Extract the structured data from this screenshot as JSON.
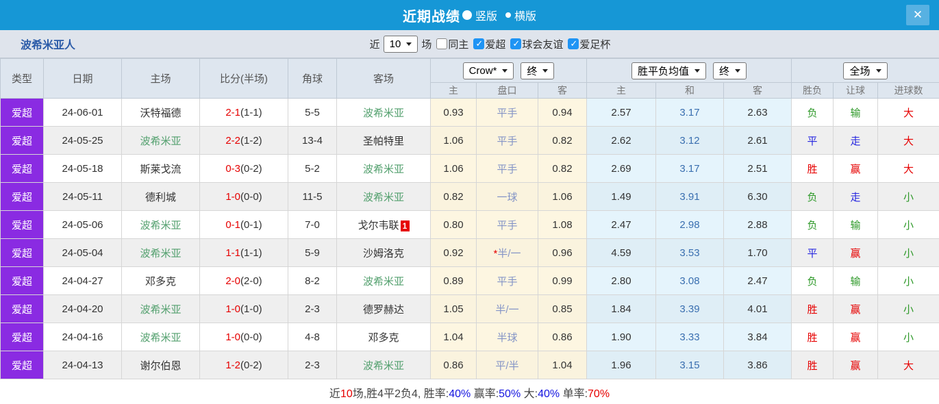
{
  "titlebar": {
    "title": "近期战绩",
    "vertical_label": "竖版",
    "horizontal_label": "横版",
    "close_icon": "✕"
  },
  "filterbar": {
    "team": "波希米亚人",
    "near_label": "近",
    "count_value": "10",
    "matches_label": "场",
    "checkboxes": [
      {
        "label": "同主",
        "checked": false
      },
      {
        "label": "爱超",
        "checked": true
      },
      {
        "label": "球会友谊",
        "checked": true
      },
      {
        "label": "爱足杯",
        "checked": true
      }
    ]
  },
  "colors": {
    "titlebar_blue": "#1697d6",
    "league_badge_purple": "#8a2be2",
    "win_red": "#e60000",
    "draw_blue": "#2626e0",
    "lose_green": "#2e9929",
    "team_green": "#53a06e",
    "draw_odds_blue": "#3a6fb0",
    "handicap_blue": "#8494c6"
  },
  "table": {
    "left_headers": [
      "类型",
      "日期",
      "主场",
      "比分(半场)",
      "角球",
      "客场"
    ],
    "selects": {
      "bookmaker": "Crow*",
      "bookmaker_period": "终",
      "avg": "胜平负均值",
      "avg_period": "终",
      "scope": "全场"
    },
    "subheaders": [
      "主",
      "盘口",
      "客",
      "主",
      "和",
      "客",
      "胜负",
      "让球",
      "进球数"
    ],
    "rows": [
      {
        "type": "爱超",
        "date": "24-06-01",
        "home": "沃特福德",
        "home_green": false,
        "score": "2-1",
        "half": "(1-1)",
        "corner": "5-5",
        "away": "波希米亚",
        "away_green": true,
        "away_badge": "",
        "crown_home": "0.93",
        "handicap": "平手",
        "handicap_star": false,
        "crown_away": "0.94",
        "odds_win": "2.57",
        "odds_draw": "3.17",
        "odds_lose": "2.63",
        "result": "负",
        "result_color": "green",
        "handicap_result": "输",
        "handicap_result_color": "green",
        "goals": "大",
        "goals_color": "red"
      },
      {
        "type": "爱超",
        "date": "24-05-25",
        "home": "波希米亚",
        "home_green": true,
        "score": "2-2",
        "half": "(1-2)",
        "corner": "13-4",
        "away": "圣帕特里",
        "away_green": false,
        "away_badge": "",
        "crown_home": "1.06",
        "handicap": "平手",
        "handicap_star": false,
        "crown_away": "0.82",
        "odds_win": "2.62",
        "odds_draw": "3.12",
        "odds_lose": "2.61",
        "result": "平",
        "result_color": "blue",
        "handicap_result": "走",
        "handicap_result_color": "blue",
        "goals": "大",
        "goals_color": "red"
      },
      {
        "type": "爱超",
        "date": "24-05-18",
        "home": "斯莱戈流",
        "home_green": false,
        "score": "0-3",
        "half": "(0-2)",
        "corner": "5-2",
        "away": "波希米亚",
        "away_green": true,
        "away_badge": "",
        "crown_home": "1.06",
        "handicap": "平手",
        "handicap_star": false,
        "crown_away": "0.82",
        "odds_win": "2.69",
        "odds_draw": "3.17",
        "odds_lose": "2.51",
        "result": "胜",
        "result_color": "red",
        "handicap_result": "赢",
        "handicap_result_color": "red",
        "goals": "大",
        "goals_color": "red"
      },
      {
        "type": "爱超",
        "date": "24-05-11",
        "home": "德利城",
        "home_green": false,
        "score": "1-0",
        "half": "(0-0)",
        "corner": "11-5",
        "away": "波希米亚",
        "away_green": true,
        "away_badge": "",
        "crown_home": "0.82",
        "handicap": "一球",
        "handicap_star": false,
        "crown_away": "1.06",
        "odds_win": "1.49",
        "odds_draw": "3.91",
        "odds_lose": "6.30",
        "result": "负",
        "result_color": "green",
        "handicap_result": "走",
        "handicap_result_color": "blue",
        "goals": "小",
        "goals_color": "green"
      },
      {
        "type": "爱超",
        "date": "24-05-06",
        "home": "波希米亚",
        "home_green": true,
        "score": "0-1",
        "half": "(0-1)",
        "corner": "7-0",
        "away": "戈尔韦联",
        "away_green": false,
        "away_badge": "1",
        "crown_home": "0.80",
        "handicap": "平手",
        "handicap_star": false,
        "crown_away": "1.08",
        "odds_win": "2.47",
        "odds_draw": "2.98",
        "odds_lose": "2.88",
        "result": "负",
        "result_color": "green",
        "handicap_result": "输",
        "handicap_result_color": "green",
        "goals": "小",
        "goals_color": "green"
      },
      {
        "type": "爱超",
        "date": "24-05-04",
        "home": "波希米亚",
        "home_green": true,
        "score": "1-1",
        "half": "(1-1)",
        "corner": "5-9",
        "away": "沙姆洛克",
        "away_green": false,
        "away_badge": "",
        "crown_home": "0.92",
        "handicap": "半/一",
        "handicap_star": true,
        "crown_away": "0.96",
        "odds_win": "4.59",
        "odds_draw": "3.53",
        "odds_lose": "1.70",
        "result": "平",
        "result_color": "blue",
        "handicap_result": "赢",
        "handicap_result_color": "red",
        "goals": "小",
        "goals_color": "green"
      },
      {
        "type": "爱超",
        "date": "24-04-27",
        "home": "邓多克",
        "home_green": false,
        "score": "2-0",
        "half": "(2-0)",
        "corner": "8-2",
        "away": "波希米亚",
        "away_green": true,
        "away_badge": "",
        "crown_home": "0.89",
        "handicap": "平手",
        "handicap_star": false,
        "crown_away": "0.99",
        "odds_win": "2.80",
        "odds_draw": "3.08",
        "odds_lose": "2.47",
        "result": "负",
        "result_color": "green",
        "handicap_result": "输",
        "handicap_result_color": "green",
        "goals": "小",
        "goals_color": "green"
      },
      {
        "type": "爱超",
        "date": "24-04-20",
        "home": "波希米亚",
        "home_green": true,
        "score": "1-0",
        "half": "(1-0)",
        "corner": "2-3",
        "away": "德罗赫达",
        "away_green": false,
        "away_badge": "",
        "crown_home": "1.05",
        "handicap": "半/一",
        "handicap_star": false,
        "crown_away": "0.85",
        "odds_win": "1.84",
        "odds_draw": "3.39",
        "odds_lose": "4.01",
        "result": "胜",
        "result_color": "red",
        "handicap_result": "赢",
        "handicap_result_color": "red",
        "goals": "小",
        "goals_color": "green"
      },
      {
        "type": "爱超",
        "date": "24-04-16",
        "home": "波希米亚",
        "home_green": true,
        "score": "1-0",
        "half": "(0-0)",
        "corner": "4-8",
        "away": "邓多克",
        "away_green": false,
        "away_badge": "",
        "crown_home": "1.04",
        "handicap": "半球",
        "handicap_star": false,
        "crown_away": "0.86",
        "odds_win": "1.90",
        "odds_draw": "3.33",
        "odds_lose": "3.84",
        "result": "胜",
        "result_color": "red",
        "handicap_result": "赢",
        "handicap_result_color": "red",
        "goals": "小",
        "goals_color": "green"
      },
      {
        "type": "爱超",
        "date": "24-04-13",
        "home": "谢尔伯恩",
        "home_green": false,
        "score": "1-2",
        "half": "(0-2)",
        "corner": "2-3",
        "away": "波希米亚",
        "away_green": true,
        "away_badge": "",
        "crown_home": "0.86",
        "handicap": "平/半",
        "handicap_star": false,
        "crown_away": "1.04",
        "odds_win": "1.96",
        "odds_draw": "3.15",
        "odds_lose": "3.86",
        "result": "胜",
        "result_color": "red",
        "handicap_result": "赢",
        "handicap_result_color": "red",
        "goals": "大",
        "goals_color": "red"
      }
    ]
  },
  "footer": {
    "parts": [
      {
        "text": "近",
        "color": "dark"
      },
      {
        "text": "10",
        "color": "red"
      },
      {
        "text": "场,胜4平2负4, 胜率:",
        "color": "dark"
      },
      {
        "text": "40%",
        "color": "blue"
      },
      {
        "text": " 赢率:",
        "color": "dark"
      },
      {
        "text": "50%",
        "color": "blue"
      },
      {
        "text": " 大:",
        "color": "dark"
      },
      {
        "text": "40%",
        "color": "blue"
      },
      {
        "text": " 单率:",
        "color": "dark"
      },
      {
        "text": "70%",
        "color": "red"
      }
    ]
  }
}
